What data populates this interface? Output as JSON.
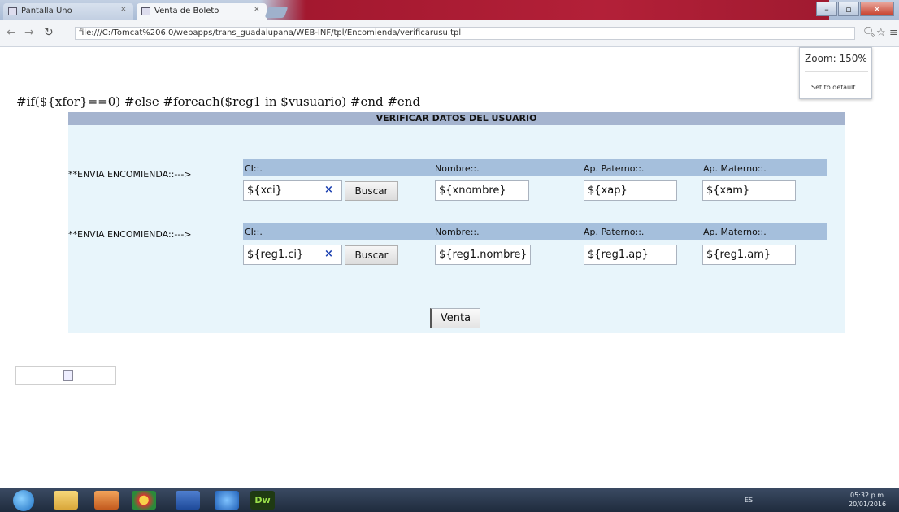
{
  "browser": {
    "tabs": [
      {
        "label": "Pantalla Uno",
        "active": false
      },
      {
        "label": "Venta de Boleto",
        "active": true
      }
    ],
    "window_title": "",
    "address": "file:///C:/Tomcat%206.0/webapps/trans_guadalupana/WEB-INF/tpl/Encomienda/verificarusu.tpl",
    "zoom_label": "Zoom: 150%",
    "zoom_reset": "Set to default"
  },
  "page": {
    "template_line": "#if(${xfor}==0) #else #foreach($reg1 in $vusuario) #end #end",
    "panel_title": "VERIFICAR DATOS DEL USUARIO",
    "rows": [
      {
        "label": "**ENVIA ENCOMIENDA::--->",
        "headers": {
          "ci": "CI::.",
          "nombre": "Nombre::.",
          "ap_paterno": "Ap. Paterno::.",
          "ap_materno": "Ap. Materno::."
        },
        "values": {
          "ci": "${xci}",
          "nombre": "${xnombre}",
          "ap_paterno": "${xap}",
          "ap_materno": "${xam}"
        },
        "clear_glyph": "×",
        "search_label": "Buscar"
      },
      {
        "label": "**ENVIA ENCOMIENDA::--->",
        "headers": {
          "ci": "CI::.",
          "nombre": "Nombre::.",
          "ap_paterno": "Ap. Paterno::.",
          "ap_materno": "Ap. Materno::."
        },
        "values": {
          "ci": "${reg1.ci}",
          "nombre": "${reg1.nombre}",
          "ap_paterno": "${reg1.ap}",
          "ap_materno": "${reg1.am}"
        },
        "clear_glyph": "×",
        "search_label": "Buscar"
      }
    ],
    "submit_label": "Venta"
  },
  "taskbar": {
    "lang": "ES",
    "time": "05:32 p.m.",
    "date": "20/01/2016",
    "apps": [
      "windows-explorer",
      "media-player",
      "chrome",
      "word",
      "ie",
      "dreamweaver"
    ],
    "dw_label": "Dw"
  },
  "colors": {
    "panel_bg": "#e8f5fb",
    "panel_header": "#a5b4cf",
    "header_strip": "#a5bfdc",
    "clear_x": "#1a3fb0"
  }
}
